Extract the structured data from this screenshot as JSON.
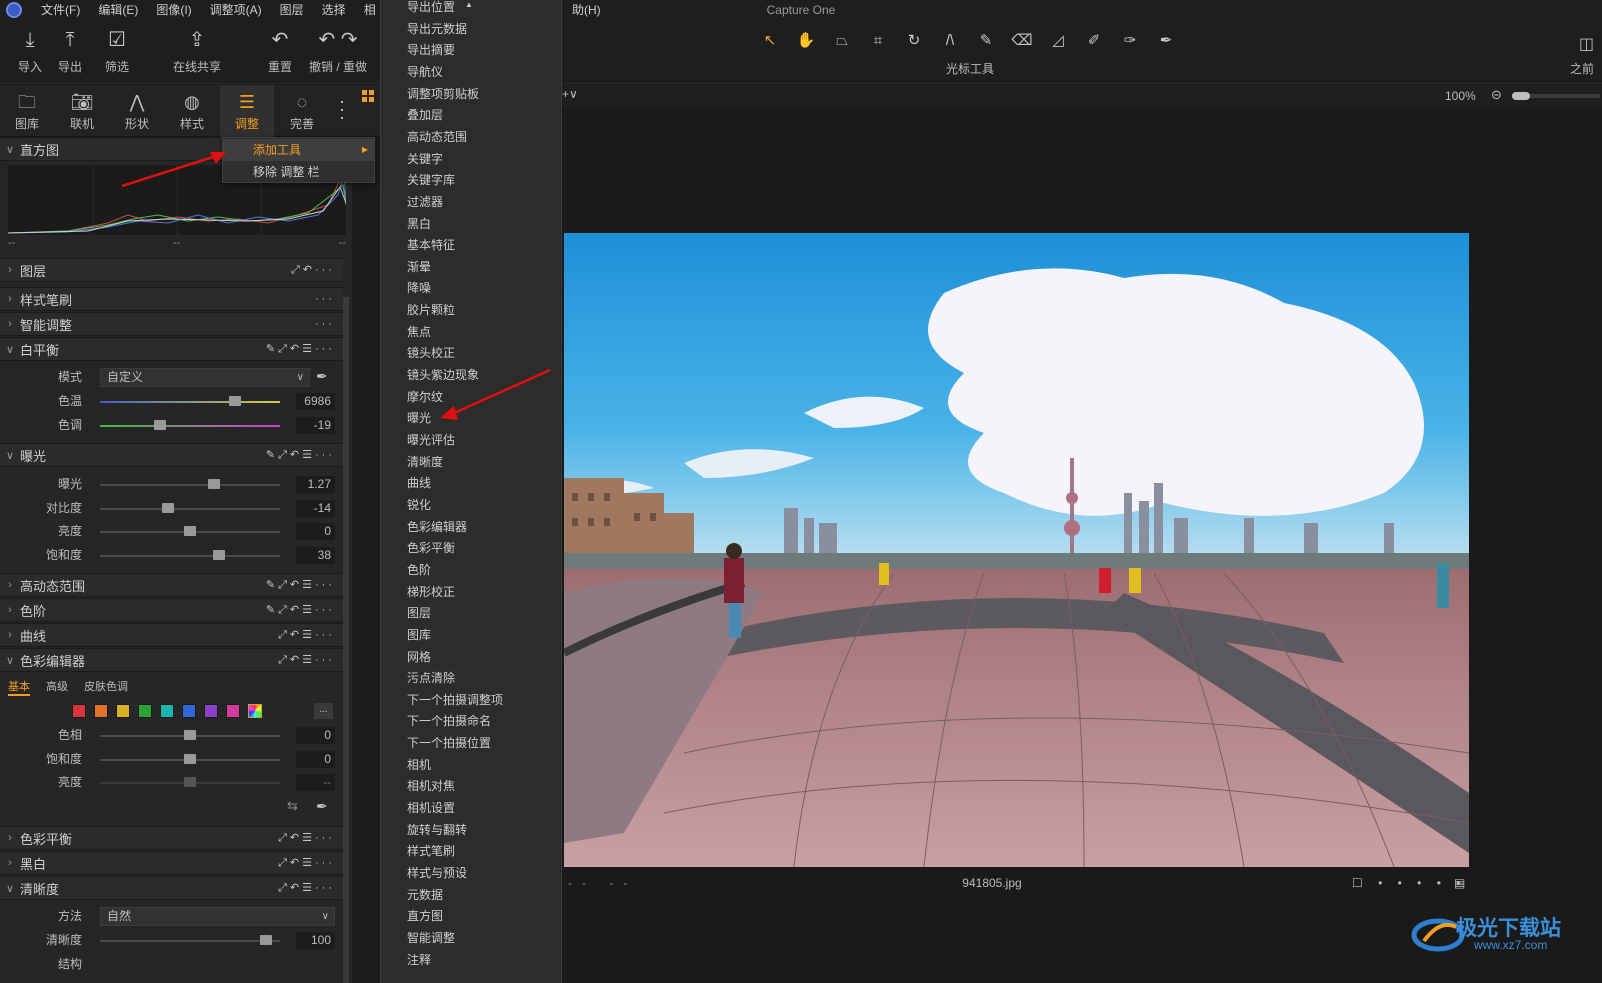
{
  "menubar": {
    "items": [
      "文件(F)",
      "编辑(E)",
      "图像(I)",
      "调整项(A)",
      "图层",
      "选择",
      "相"
    ],
    "help_fragment": "助(H)",
    "window_title": "Capture One"
  },
  "toolbar": {
    "import": "导入",
    "export": "导出",
    "filter": "筛选",
    "share": "在线共享",
    "reset": "重置",
    "undo_redo": "撤销 / 重做",
    "cursor_tools_label": "光标工具",
    "compare": "之前"
  },
  "tool_tabs": [
    {
      "label": "图库",
      "icon": "folder-icon"
    },
    {
      "label": "联机",
      "icon": "camera-icon"
    },
    {
      "label": "形状",
      "icon": "lens-icon"
    },
    {
      "label": "样式",
      "icon": "style-icon"
    },
    {
      "label": "调整",
      "icon": "sliders-icon",
      "active": true
    },
    {
      "label": "完善",
      "icon": "refine-icon"
    }
  ],
  "context_menu": {
    "add_tool": "添加工具",
    "remove_tab": "移除 调整 栏"
  },
  "tool_list": [
    "导出位置",
    "导出元数据",
    "导出摘要",
    "导航仪",
    "调整项剪贴板",
    "叠加层",
    "高动态范围",
    "关键字",
    "关键字库",
    "过滤器",
    "黑白",
    "基本特征",
    "渐晕",
    "降噪",
    "胶片颗粒",
    "焦点",
    "镜头校正",
    "镜头紫边现象",
    "摩尔纹",
    "曝光",
    "曝光评估",
    "清晰度",
    "曲线",
    "锐化",
    "色彩编辑器",
    "色彩平衡",
    "色阶",
    "梯形校正",
    "图层",
    "图库",
    "网格",
    "污点清除",
    "下一个拍摄调整项",
    "下一个拍摄命名",
    "下一个拍摄位置",
    "相机",
    "相机对焦",
    "相机设置",
    "旋转与翻转",
    "样式笔刷",
    "样式与预设",
    "元数据",
    "直方图",
    "智能调整",
    "注释"
  ],
  "left_panel": {
    "histogram": {
      "title": "直方图",
      "foot_left": "--",
      "foot_mid": "--",
      "foot_right": "--"
    },
    "layers": {
      "title": "图层"
    },
    "style_brush": {
      "title": "样式笔刷"
    },
    "smart_adjust": {
      "title": "智能调整"
    },
    "white_balance": {
      "title": "白平衡",
      "mode_label": "模式",
      "mode_value": "自定义",
      "temp_label": "色温",
      "temp_value": "6986",
      "temp_pos": 0.77,
      "tint_label": "色调",
      "tint_value": "-19",
      "tint_pos": 0.32
    },
    "exposure": {
      "title": "曝光",
      "exposure_label": "曝光",
      "exposure_value": "1.27",
      "exposure_pos": 0.64,
      "contrast_label": "对比度",
      "contrast_value": "-14",
      "contrast_pos": 0.37,
      "brightness_label": "亮度",
      "brightness_value": "0",
      "brightness_pos": 0.5,
      "saturation_label": "饱和度",
      "saturation_value": "38",
      "saturation_pos": 0.67
    },
    "hdr": {
      "title": "高动态范围"
    },
    "levels": {
      "title": "色阶"
    },
    "curves": {
      "title": "曲线"
    },
    "color_editor": {
      "title": "色彩编辑器",
      "tabs": [
        "基本",
        "高级",
        "皮肤色调"
      ],
      "swatches": [
        "#d9333a",
        "#e0722a",
        "#d9b021",
        "#29a334",
        "#1ab5b0",
        "#3366d6",
        "#8a3fc9",
        "#d13c9a"
      ],
      "more": "...",
      "hue_label": "色相",
      "hue_value": "0",
      "sat_label": "饱和度",
      "sat_value": "0",
      "light_label": "亮度",
      "light_value": "--"
    },
    "color_balance": {
      "title": "色彩平衡"
    },
    "bw": {
      "title": "黑白"
    },
    "clarity": {
      "title": "清晰度",
      "method_label": "方法",
      "method_value": "自然",
      "clarity_label": "清晰度",
      "clarity_value": "100",
      "clarity_pos": 0.95,
      "structure_label": "结构"
    }
  },
  "viewer": {
    "zoom": "100%",
    "filename": "941805.jpg",
    "dashes": "-- --"
  },
  "watermark": {
    "text": "极光下载站",
    "url": "www.xz7.com"
  }
}
